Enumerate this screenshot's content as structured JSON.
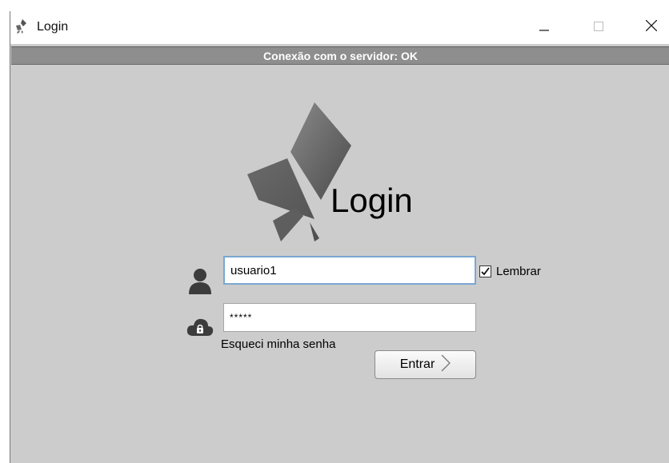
{
  "window": {
    "title": "Login"
  },
  "status": {
    "text": "Conexão com o servidor: OK"
  },
  "logo": {
    "text": "Login"
  },
  "form": {
    "username_value": "usuario1",
    "password_value": "*****",
    "remember_label": "Lembrar",
    "remember_checked": true,
    "forgot_label": "Esqueci minha senha",
    "submit_label": "Entrar"
  },
  "icons": {
    "app": "app-logo-icon",
    "minimize": "minimize-icon",
    "maximize": "maximize-icon",
    "close": "close-icon",
    "user": "user-icon",
    "lock": "cloud-lock-icon",
    "submit": "chevron-right-icon"
  }
}
